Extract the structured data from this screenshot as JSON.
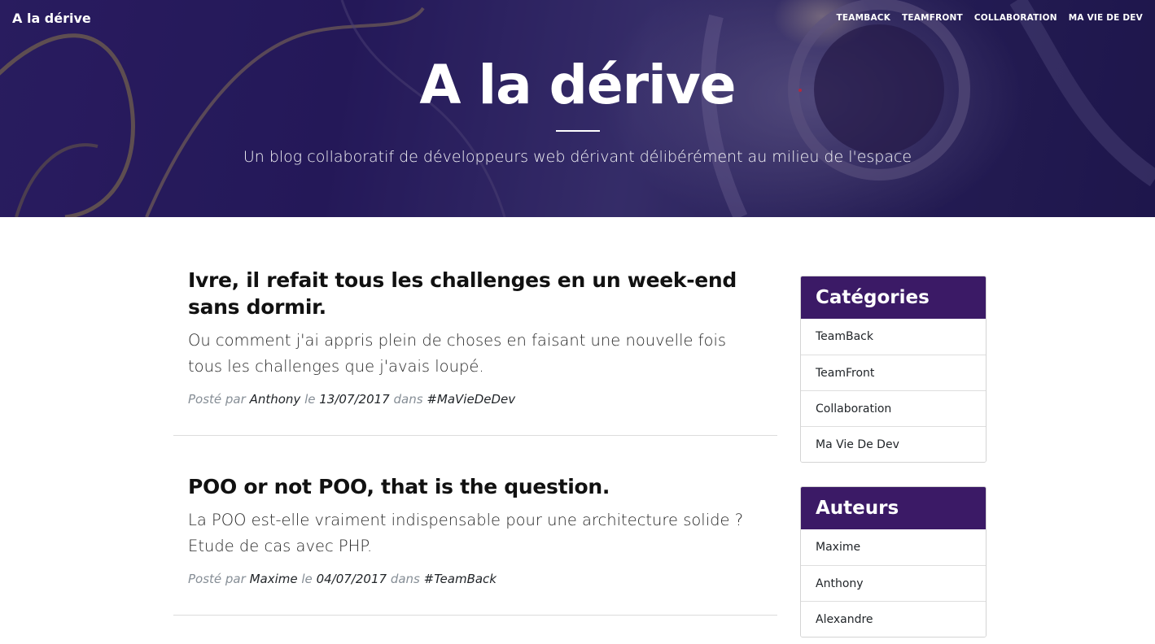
{
  "navbar": {
    "brand": "A la dérive",
    "links": [
      "TEAMBACK",
      "TEAMFRONT",
      "COLLABORATION",
      "MA VIE DE DEV"
    ]
  },
  "header": {
    "title": "A la dérive",
    "subtitle": "Un blog collaboratif de développeurs web dérivant délibérément au milieu de l'espace"
  },
  "posts": [
    {
      "title": "Ivre, il refait tous les challenges en un week-end sans dormir.",
      "subtitle": "Ou comment j'ai appris plein de choses en faisant une nouvelle fois tous les challenges que j'avais loupé.",
      "meta_prefix": "Posté par",
      "author": "Anthony",
      "meta_date_prefix": "le",
      "date": "13/07/2017",
      "meta_cat_prefix": "dans",
      "category": "#MaVieDeDev"
    },
    {
      "title": "POO or not POO, that is the question.",
      "subtitle": "La POO est-elle vraiment indispensable pour une architecture solide ? Etude de cas avec PHP.",
      "meta_prefix": "Posté par",
      "author": "Maxime",
      "meta_date_prefix": "le",
      "date": "04/07/2017",
      "meta_cat_prefix": "dans",
      "category": "#TeamBack"
    }
  ],
  "sidebar": {
    "categories": {
      "title": "Catégories",
      "items": [
        "TeamBack",
        "TeamFront",
        "Collaboration",
        "Ma Vie De Dev"
      ]
    },
    "authors": {
      "title": "Auteurs",
      "items": [
        "Maxime",
        "Anthony",
        "Alexandre"
      ]
    }
  },
  "colors": {
    "header_overlay": "#2a1f5e",
    "card_header": "#3b1a66",
    "meta_text": "#868e96"
  },
  "icons": {
    "header_image": "astronaut-space-photo"
  }
}
